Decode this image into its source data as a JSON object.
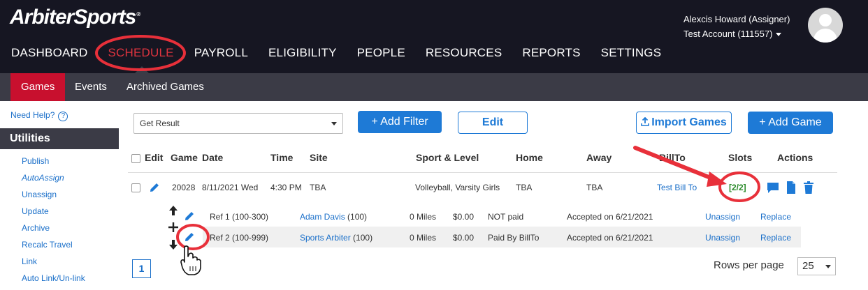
{
  "brand": {
    "logo_part1": "Arbiter",
    "logo_part2": "Sports",
    "tm": "®"
  },
  "user": {
    "name": "Alexcis Howard (Assigner)",
    "account": "Test Account (111557)"
  },
  "nav": [
    "DASHBOARD",
    "SCHEDULE",
    "PAYROLL",
    "ELIGIBILITY",
    "PEOPLE",
    "RESOURCES",
    "REPORTS",
    "SETTINGS"
  ],
  "subtabs": [
    "Games",
    "Events",
    "Archived Games"
  ],
  "sidebar": {
    "help": "Need Help?",
    "help_icon": "?",
    "heading": "Utilities",
    "items": [
      "Publish",
      "AutoAssign",
      "Unassign",
      "Update",
      "Archive",
      "Recalc Travel",
      "Link",
      "Auto Link/Un-link"
    ]
  },
  "toolbar": {
    "select_value": "Get Result",
    "add_filter": "+ Add Filter",
    "edit": "Edit",
    "import_games": "Import Games",
    "add_game": "+ Add Game"
  },
  "table": {
    "headers": [
      "Edit",
      "Game",
      "Date",
      "Time",
      "Site",
      "Sport & Level",
      "Home",
      "Away",
      "BillTo",
      "Slots",
      "Actions"
    ],
    "game": {
      "id": "20028",
      "date": "8/11/2021 Wed",
      "time": "4:30 PM",
      "site": "TBA",
      "sport_level": "Volleyball, Varsity Girls",
      "home": "TBA",
      "away": "TBA",
      "bill_to": "Test Bill To",
      "slots": "[2/2]"
    },
    "officials": [
      {
        "position": "Ref 1 (100-300)",
        "name": "Adam Davis",
        "num": "(100)",
        "miles": "0 Miles",
        "amount": "$0.00",
        "paid": "NOT paid",
        "status": "Accepted on 6/21/2021",
        "unassign": "Unassign",
        "replace": "Replace"
      },
      {
        "position": "Ref 2 (100-999)",
        "name": "Sports Arbiter",
        "num": "(100)",
        "miles": "0 Miles",
        "amount": "$0.00",
        "paid": "Paid By BillTo",
        "status": "Accepted on 6/21/2021",
        "unassign": "Unassign",
        "replace": "Replace"
      }
    ]
  },
  "pagination": {
    "page": "1",
    "rows_label": "Rows per page",
    "rows_value": "25"
  },
  "colors": {
    "topbar": "#161622",
    "accent_red": "#c8102e",
    "link_blue": "#1a6fc9",
    "button_blue": "#1e7ad6",
    "annotation_red": "#e8303a"
  }
}
